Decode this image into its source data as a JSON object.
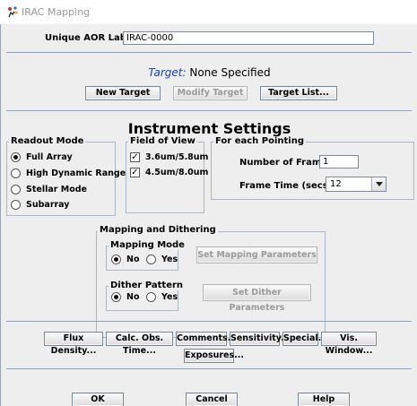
{
  "window": {
    "title": "IRAC Mapping",
    "app_icon": "juggler-icon"
  },
  "aor": {
    "label": "Unique AOR Label:",
    "value": "IRAC-0000"
  },
  "target": {
    "label": "Target:",
    "value": "None Specified",
    "buttons": {
      "new": "New Target",
      "modify": "Modify Target",
      "list": "Target List..."
    }
  },
  "instrument": {
    "heading": "Instrument Settings",
    "readout_mode": {
      "title": "Readout Mode",
      "options": [
        "Full Array",
        "High Dynamic Range",
        "Stellar Mode",
        "Subarray"
      ],
      "selected": "Full Array"
    },
    "field_of_view": {
      "title": "Field of View",
      "options": [
        {
          "label": "3.6um/5.8um",
          "checked": true
        },
        {
          "label": "4.5um/8.0um",
          "checked": true
        }
      ]
    },
    "pointing": {
      "title": "For each Pointing",
      "frames_label": "Number of Frames:",
      "frames_value": "1",
      "frame_time_label": "Frame Time (secs):",
      "frame_time_value": "12"
    }
  },
  "mapping": {
    "title": "Mapping and Dithering",
    "mapping_mode": {
      "title": "Mapping Mode",
      "no": "No",
      "yes": "Yes",
      "selected": "No"
    },
    "set_mapping": "Set Mapping Parameters",
    "dither_pattern": {
      "title": "Dither Pattern",
      "no": "No",
      "yes": "Yes",
      "selected": "No"
    },
    "set_dither": "Set Dither Parameters"
  },
  "tools": {
    "flux": "Flux Density...",
    "calc": "Calc. Obs. Time...",
    "comments": "Comments...",
    "sensitivity": "Sensitivity...",
    "special": "Special...",
    "vis": "Vis. Window...",
    "exposures": "Exposures..."
  },
  "footer": {
    "ok": "OK",
    "cancel": "Cancel",
    "help": "Help"
  }
}
